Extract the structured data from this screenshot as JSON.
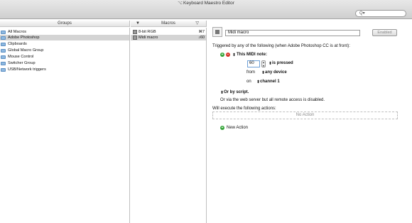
{
  "window": {
    "title": "Keyboard Maestro Editor",
    "title_icon": "km-icon"
  },
  "search": {
    "icon": "search-icon",
    "glyph": "Q▾"
  },
  "groups": {
    "header": "Groups",
    "items": [
      {
        "label": "All Macros",
        "selected": false
      },
      {
        "label": "Adobe Photoshop",
        "selected": true
      },
      {
        "label": "Clipboards",
        "selected": false
      },
      {
        "label": "Global Macro Group",
        "selected": false
      },
      {
        "label": "Mouse Control",
        "selected": false
      },
      {
        "label": "Switcher Group",
        "selected": false
      },
      {
        "label": "USB/Network triggers",
        "selected": false
      }
    ]
  },
  "macros": {
    "header": "Macros",
    "sort_left": "▼",
    "sort_right": "▽",
    "items": [
      {
        "label": "8-bit RGB",
        "trigger": "⌘7",
        "selected": false
      },
      {
        "label": "Midi macro",
        "trigger": "♪60",
        "selected": true
      }
    ]
  },
  "editor": {
    "macro_name": "Midi macro",
    "enabled_label": "Enabled",
    "triggered_by": "Triggered by any of the following (when Adobe Photoshop CC is at front):",
    "trigger_title": "This MIDI note:",
    "note_value": "60",
    "is_pressed": "is pressed",
    "from_label": "from",
    "from_value": "any device",
    "on_label": "on",
    "on_value": "channel 1",
    "or_by_script": "Or by script.",
    "web_server_note": "Or via the web server but all remote access is disabled.",
    "will_execute": "Will execute the following actions:",
    "no_action": "No Action",
    "new_action": "New Action",
    "popup_glyph": "⬍",
    "add_glyph": "+",
    "remove_glyph": "−"
  },
  "colors": {
    "selection": "#d4d4d4",
    "add_green": "#31a335",
    "remove_red": "#d7352b",
    "folder_blue": "#8fb9e0"
  }
}
